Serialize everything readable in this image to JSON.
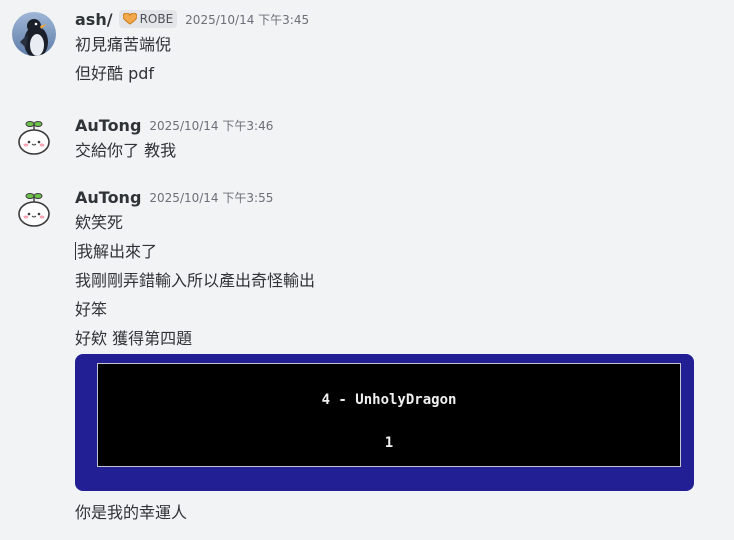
{
  "messages": [
    {
      "username": "ash/",
      "tag": "ROBE",
      "timestamp": "2025/10/14 下午3:45",
      "lines": [
        "初見痛苦端倪",
        "但好酷 pdf"
      ]
    },
    {
      "username": "AuTong",
      "timestamp": "2025/10/14 下午3:46",
      "lines": [
        "交給你了 教我"
      ]
    },
    {
      "username": "AuTong",
      "timestamp": "2025/10/14 下午3:55",
      "lines": [
        "欸笑死",
        "我解出來了",
        "我剛剛弄錯輸入所以產出奇怪輸出",
        "好笨",
        "好欸 獲得第四題"
      ]
    }
  ],
  "embed": {
    "title": "4 - UnholyDragon",
    "value": "1"
  },
  "trailing_line": "你是我的幸運人",
  "icons": {
    "ash_avatar": "penguin-avatar",
    "autong_avatar": "sprout-bun-avatar",
    "tag_icon": "orange-heart-icon"
  },
  "colors": {
    "background": "#f2f3f5",
    "embed_border": "#211f93",
    "embed_bg": "#000000"
  }
}
